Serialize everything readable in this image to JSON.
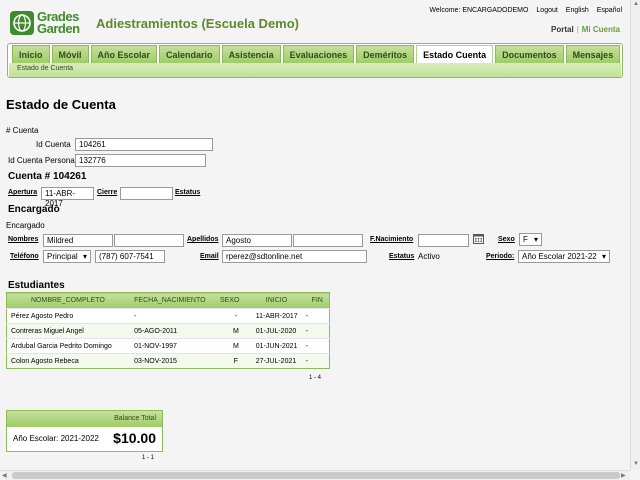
{
  "logo": {
    "line1": "Grades",
    "line2": "Garden"
  },
  "header": {
    "title": "Adiestramientos (Escuela Demo)",
    "welcome": "Welcome: ENCARGADODEMO",
    "logout": "Logout",
    "english": "English",
    "spanish": "Español",
    "portal": "Portal",
    "mi_cuenta": "Mi Cuenta"
  },
  "nav": {
    "tabs": [
      "Inicio",
      "Móvil",
      "Año Escolar",
      "Calendario",
      "Asistencia",
      "Evaluaciones",
      "Deméritos",
      "Estado Cuenta",
      "Documentos",
      "Mensajes"
    ],
    "active_index": 7,
    "sub_label": "Estado de Cuenta"
  },
  "page": {
    "title": "Estado de Cuenta"
  },
  "account": {
    "section_label": "# Cuenta",
    "id_cuenta_label": "Id Cuenta",
    "id_cuenta_value": "104261",
    "id_persona_label": "Id Cuenta Persona",
    "id_persona_value": "132776",
    "heading": "Cuenta # 104261",
    "apertura_label": "Apertura",
    "apertura_value": "11-ABR-2017",
    "cierre_label": "Cierre",
    "cierre_value": "",
    "estatus_label": "Estatus"
  },
  "encargado": {
    "heading": "Encargado",
    "sub_label": "Encargado",
    "nombres_label": "Nombres",
    "nombre1": "Mildred",
    "nombre2": "",
    "apellidos_label": "Apellidos",
    "apellido1": "Agosto",
    "apellido2": "",
    "nacimiento_label": "F.Nacimiento",
    "nacimiento_value": "",
    "sexo_label": "Sexo",
    "sexo_value": "F",
    "telefono_label": "Teléfono",
    "telefono_tipo": "Principal",
    "telefono_value": "(787) 607-7541",
    "email_label": "Email",
    "email_value": "rperez@sdtonline.net",
    "estatus_label": "Estatus",
    "estatus_value": "Activo",
    "periodo_label": "Periodo:",
    "periodo_value": "Año Escolar 2021-22"
  },
  "students": {
    "heading": "Estudiantes",
    "columns": [
      "NOMBRE_COMPLETO",
      "FECHA_NACIMIENTO",
      "SEXO",
      "INICIO",
      "FIN"
    ],
    "rows": [
      [
        "Pérez Agosto Pedro",
        "-",
        "-",
        "11-ABR-2017",
        "-"
      ],
      [
        "Contreras Miguel Angel",
        "05-AGO-2011",
        "M",
        "01-JUL-2020",
        "-"
      ],
      [
        "Ardubal Garcia Pedrito Domingo",
        "01-NOV-1997",
        "M",
        "01-JUN-2021",
        "-"
      ],
      [
        "Colon Agosto Rebeca",
        "03-NOV-2015",
        "F",
        "27-JUL-2021",
        "-"
      ]
    ],
    "pager": "1 - 4"
  },
  "balance": {
    "header": "Balance Total",
    "year_label": "Año Escolar: 2021-2022",
    "amount": "$10.00",
    "pager": "1 - 1"
  },
  "colors": {
    "accent": "#9fcc67",
    "brand": "#3e8a2c",
    "title": "#5b8a2e"
  }
}
